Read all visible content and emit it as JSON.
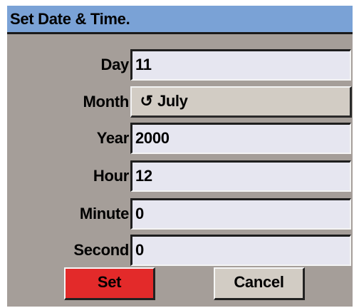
{
  "dialog": {
    "title": "Set Date & Time.",
    "fields": {
      "day": {
        "label": "Day",
        "value": "11"
      },
      "month": {
        "label": "Month",
        "value": "July",
        "icon": "cycle-icon"
      },
      "year": {
        "label": "Year",
        "value": "2000"
      },
      "hour": {
        "label": "Hour",
        "value": "12"
      },
      "minute": {
        "label": "Minute",
        "value": "0"
      },
      "second": {
        "label": "Second",
        "value": "0"
      }
    },
    "buttons": {
      "set": "Set",
      "cancel": "Cancel"
    },
    "colors": {
      "titlebar": "#7aa2d6",
      "window": "#a59e99",
      "field": "#e6e6f0",
      "set_button": "#e32a2a",
      "cancel_button": "#d2ccc4"
    }
  }
}
